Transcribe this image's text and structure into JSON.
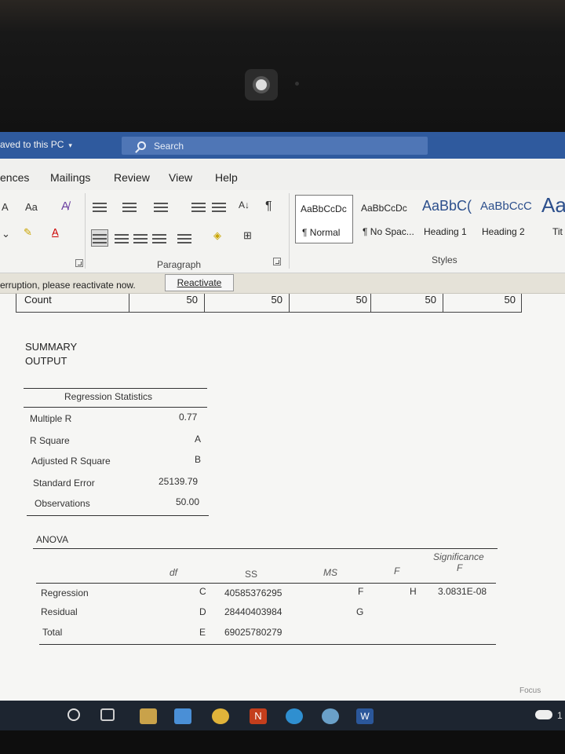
{
  "titlebar": {
    "saved_status": "aved to this PC",
    "saved_caret": "▾",
    "search_placeholder": "Search"
  },
  "tabs": [
    "ences",
    "Mailings",
    "Review",
    "View",
    "Help"
  ],
  "ribbon": {
    "font_grow": "A",
    "change_case": "Aa",
    "font_color_letter": "A",
    "paragraph_label": "Paragraph",
    "styles_label": "Styles",
    "pilcrow": "¶",
    "sort": "A↓",
    "styles": [
      {
        "preview": "AaBbCcDc",
        "name": "¶ Normal"
      },
      {
        "preview": "AaBbCcDc",
        "name": "¶ No Spac..."
      },
      {
        "preview": "AaBbC(",
        "name": "Heading 1"
      },
      {
        "preview": "AaBbCcC",
        "name": "Heading 2"
      },
      {
        "preview": "Aa",
        "name": "Tit"
      }
    ]
  },
  "notice": {
    "text": "erruption, please reactivate now.",
    "button": "Reactivate"
  },
  "document": {
    "count_row": {
      "label": "Count",
      "values": [
        "50",
        "50",
        "50",
        "50",
        "50"
      ]
    },
    "summary_title_1": "SUMMARY",
    "summary_title_2": "OUTPUT",
    "regression_stats_title": "Regression Statistics",
    "regression_stats": [
      {
        "label": "Multiple R",
        "value": "0.77"
      },
      {
        "label": "R Square",
        "value": "A"
      },
      {
        "label": "Adjusted R Square",
        "value": "B"
      },
      {
        "label": "Standard Error",
        "value": "25139.79"
      },
      {
        "label": "Observations",
        "value": "50.00"
      }
    ],
    "anova_title": "ANOVA",
    "anova_headers": {
      "df": "df",
      "ss": "SS",
      "ms": "MS",
      "f": "F",
      "sig_1": "Significance",
      "sig_2": "F"
    },
    "anova_rows": [
      {
        "label": "Regression",
        "df": "C",
        "ss": "40585376295",
        "ms": "F",
        "f": "H",
        "sig": "3.0831E-08"
      },
      {
        "label": "Residual",
        "df": "D",
        "ss": "28440403984",
        "ms": "G",
        "f": "",
        "sig": ""
      },
      {
        "label": "Total",
        "df": "E",
        "ss": "69025780279",
        "ms": "",
        "f": "",
        "sig": ""
      }
    ]
  },
  "taskbar": {
    "focus_label": "Focus",
    "word_letter": "W",
    "onenote_letter": "N",
    "tray_time": "1"
  },
  "colors": {
    "titlebar": "#2f5a9e",
    "taskbar": "#1d2530",
    "word_blue": "#2b579a",
    "onenote_purple": "#c43e1c"
  }
}
